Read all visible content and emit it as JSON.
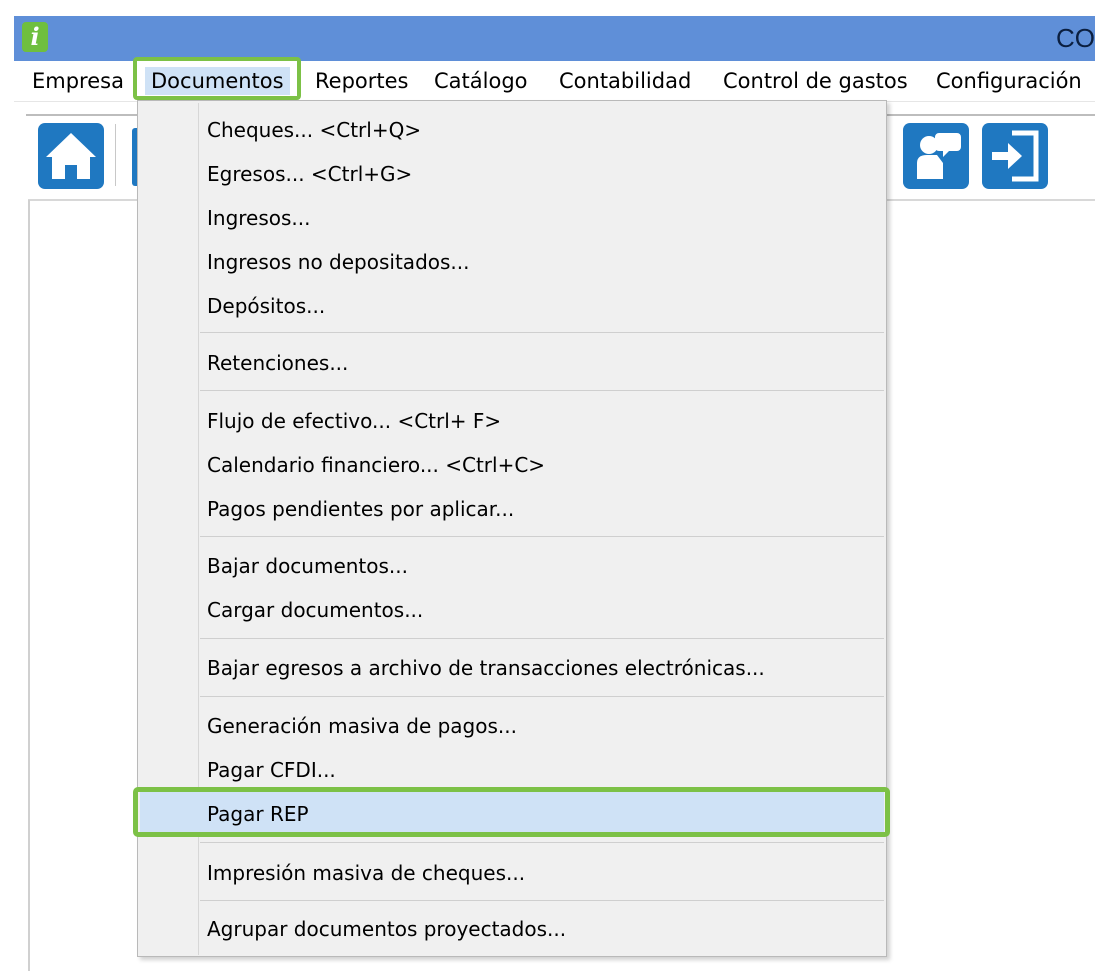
{
  "window": {
    "title": "CO"
  },
  "menubar": {
    "items": [
      {
        "label": "Empresa"
      },
      {
        "label": "Documentos"
      },
      {
        "label": "Reportes"
      },
      {
        "label": "Catálogo"
      },
      {
        "label": "Contabilidad"
      },
      {
        "label": "Control de gastos"
      },
      {
        "label": "Configuración"
      }
    ],
    "active": "Documentos"
  },
  "toolbar": {
    "buttons": [
      {
        "icon": "home-icon"
      },
      {
        "icon": "help-icon"
      },
      {
        "icon": "exit-icon"
      }
    ]
  },
  "documentos_menu": {
    "items": [
      {
        "label": "Cheques... <Ctrl+Q>"
      },
      {
        "label": "Egresos... <Ctrl+G>"
      },
      {
        "label": "Ingresos..."
      },
      {
        "label": "Ingresos no depositados..."
      },
      {
        "label": "Depósitos..."
      },
      {
        "label": "Retenciones..."
      },
      {
        "label": "Flujo de efectivo... <Ctrl+ F>"
      },
      {
        "label": "Calendario financiero... <Ctrl+C>"
      },
      {
        "label": "Pagos pendientes por aplicar..."
      },
      {
        "label": "Bajar documentos..."
      },
      {
        "label": "Cargar documentos..."
      },
      {
        "label": "Bajar egresos a archivo de transacciones electrónicas..."
      },
      {
        "label": "Generación masiva de pagos..."
      },
      {
        "label": "Pagar CFDI..."
      },
      {
        "label": "Pagar REP"
      },
      {
        "label": "Impresión masiva de cheques..."
      },
      {
        "label": "Agrupar documentos proyectados..."
      }
    ],
    "highlighted": "Pagar REP"
  },
  "colors": {
    "titlebar": "#5f8fd8",
    "highlight_border": "#7cc146",
    "selection": "#cfe2f6",
    "toolbar_button": "#1f78c1"
  }
}
